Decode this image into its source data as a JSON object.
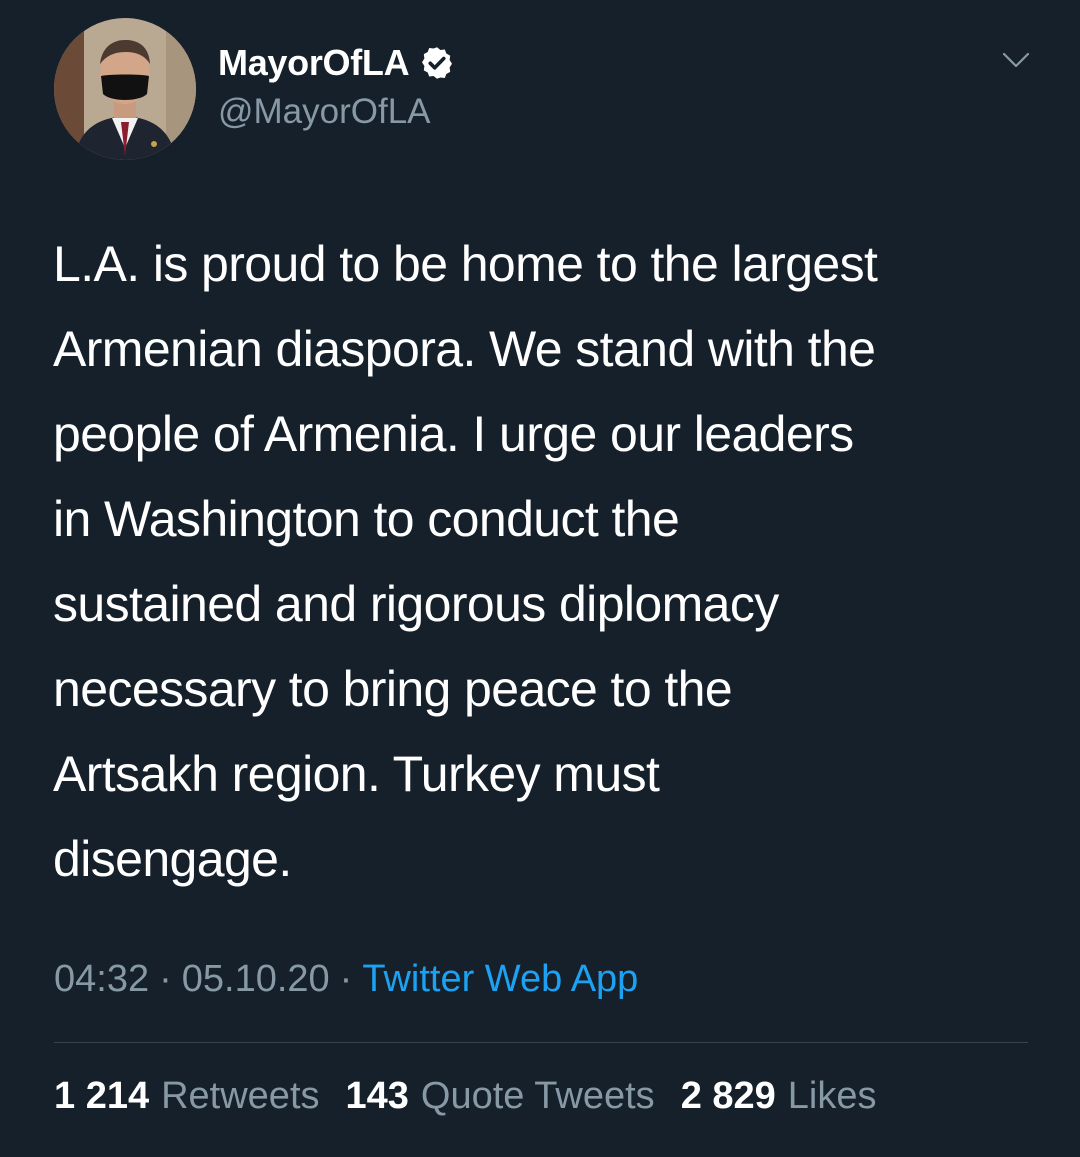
{
  "tweet": {
    "author": {
      "display_name": "MayorOfLA",
      "handle": "@MayorOfLA",
      "verified_icon": "verified-badge-icon",
      "avatar_icon": "avatar-photo"
    },
    "menu_icon": "chevron-down-icon",
    "text": "L.A. is proud to be home to the largest\nArmenian diaspora. We stand with the\npeople of Armenia. I urge our leaders\nin Washington to conduct the\nsustained and rigorous diplomacy\nnecessary to bring peace to the\nArtsakh region. Turkey must\ndisengage.",
    "time": "04:32",
    "date": "05.10.20",
    "separator": "·",
    "source": "Twitter Web App",
    "stats": {
      "retweets_count": "1 214",
      "retweets_label": "Retweets",
      "quotes_count": "143",
      "quotes_label": "Quote Tweets",
      "likes_count": "2 829",
      "likes_label": "Likes"
    }
  },
  "colors": {
    "background": "#15202b",
    "primary_text": "#ffffff",
    "secondary_text": "#8899a6",
    "link": "#1da1f2",
    "divider": "#38444d"
  }
}
